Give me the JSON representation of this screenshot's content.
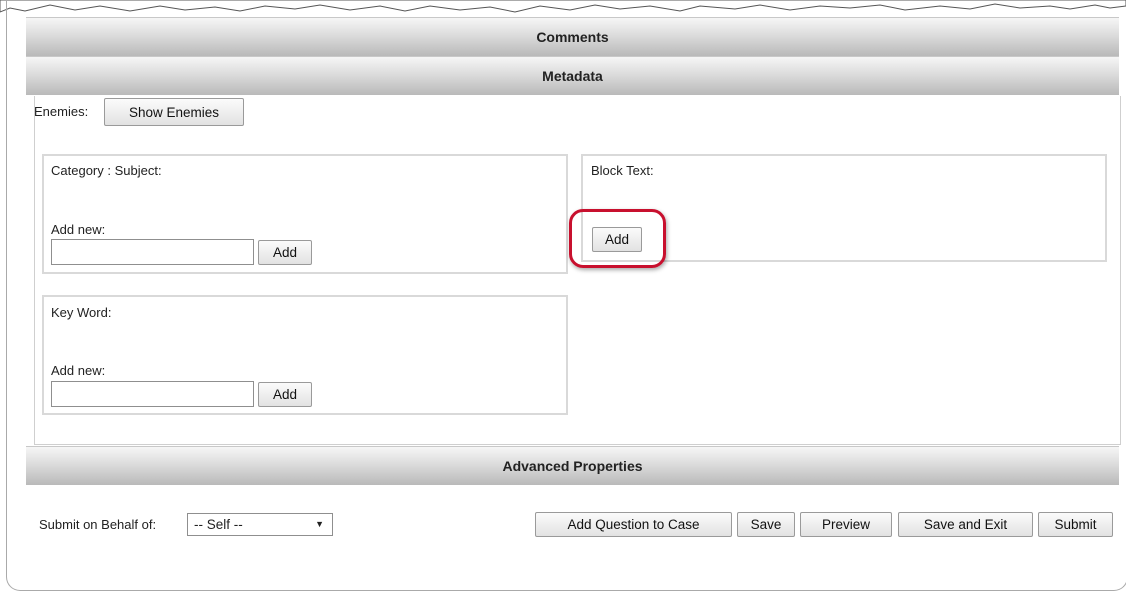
{
  "sections": {
    "comments": "Comments",
    "metadata": "Metadata",
    "advanced": "Advanced Properties"
  },
  "enemies": {
    "label": "Enemies:",
    "button": "Show Enemies"
  },
  "category_panel": {
    "title": "Category : Subject:",
    "add_new_label": "Add new:",
    "input_value": "",
    "add_button": "Add"
  },
  "keyword_panel": {
    "title": "Key Word:",
    "add_new_label": "Add new:",
    "input_value": "",
    "add_button": "Add"
  },
  "block_text_panel": {
    "title": "Block Text:",
    "add_button": "Add"
  },
  "footer": {
    "behalf_label": "Submit on Behalf of:",
    "behalf_selected": "-- Self --",
    "buttons": {
      "add_question": "Add Question to Case",
      "save": "Save",
      "preview": "Preview",
      "save_exit": "Save and Exit",
      "submit": "Submit"
    }
  },
  "colors": {
    "highlight": "#c8102e",
    "bar_gradient_top": "#f6f6f6",
    "bar_gradient_bottom": "#b9b9b9"
  }
}
